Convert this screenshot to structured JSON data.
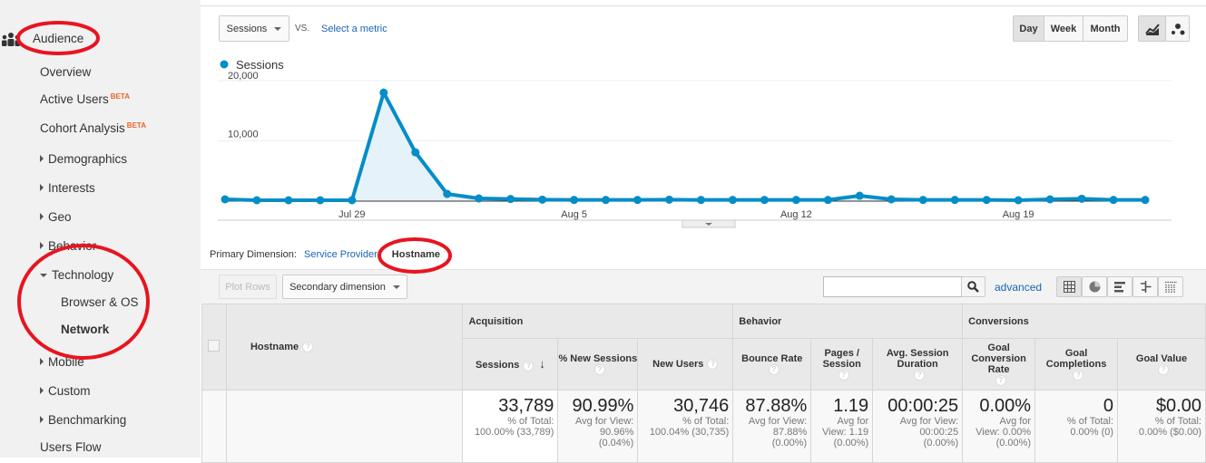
{
  "sidebar": {
    "section": "Audience",
    "items": [
      {
        "label": "Overview"
      },
      {
        "label": "Active Users",
        "badge": "BETA"
      },
      {
        "label": "Cohort Analysis",
        "badge": "BETA"
      },
      {
        "label": "Demographics"
      },
      {
        "label": "Interests"
      },
      {
        "label": "Geo"
      },
      {
        "label": "Behavior"
      },
      {
        "label": "Technology"
      },
      {
        "label": "Browser & OS"
      },
      {
        "label": "Network"
      },
      {
        "label": "Mobile"
      },
      {
        "label": "Custom"
      },
      {
        "label": "Benchmarking"
      },
      {
        "label": "Users Flow"
      }
    ]
  },
  "controls": {
    "metric": "Sessions",
    "vs": "VS.",
    "select_metric": "Select a metric",
    "day": "Day",
    "week": "Week",
    "month": "Month",
    "selected_interval": "Day"
  },
  "chart_data": {
    "type": "area",
    "legend": [
      "Sessions"
    ],
    "color": "#058dc7",
    "y_ticks": [
      "20,000",
      "10,000"
    ],
    "ylim": [
      0,
      22000
    ],
    "x_ticks": [
      "Jul 29",
      "Aug 5",
      "Aug 12",
      "Aug 19"
    ],
    "x": [
      "Jul 25",
      "Jul 26",
      "Jul 27",
      "Jul 28",
      "Jul 29",
      "Jul 30",
      "Jul 31",
      "Aug 1",
      "Aug 2",
      "Aug 3",
      "Aug 4",
      "Aug 5",
      "Aug 6",
      "Aug 7",
      "Aug 8",
      "Aug 9",
      "Aug 10",
      "Aug 11",
      "Aug 12",
      "Aug 13",
      "Aug 14",
      "Aug 15",
      "Aug 16",
      "Aug 17",
      "Aug 18",
      "Aug 19",
      "Aug 20",
      "Aug 21",
      "Aug 22",
      "Aug 23"
    ],
    "series": [
      {
        "name": "Sessions",
        "values": [
          300,
          150,
          150,
          150,
          150,
          18000,
          8100,
          1200,
          450,
          350,
          250,
          200,
          200,
          200,
          250,
          200,
          200,
          200,
          200,
          200,
          900,
          300,
          200,
          200,
          200,
          150,
          300,
          400,
          200,
          200
        ]
      }
    ]
  },
  "dimension": {
    "label": "Primary Dimension:",
    "service_provider": "Service Provider",
    "hostname": "Hostname"
  },
  "toolbar": {
    "plot_rows": "Plot Rows",
    "secondary": "Secondary dimension",
    "search_value": "",
    "advanced": "advanced"
  },
  "table": {
    "hostname_header": "Hostname",
    "groups": [
      "Acquisition",
      "Behavior",
      "Conversions"
    ],
    "columns": [
      {
        "label": "Sessions",
        "big": "33,789",
        "sub": [
          "% of Total:",
          "100.00% (33,789)"
        ]
      },
      {
        "label": "% New Sessions",
        "big": "90.99%",
        "sub": [
          "Avg for View:",
          "90.96%",
          "(0.04%)"
        ]
      },
      {
        "label": "New Users",
        "big": "30,746",
        "sub": [
          "% of Total:",
          "100.04% (30,735)"
        ]
      },
      {
        "label": "Bounce Rate",
        "big": "87.88%",
        "sub": [
          "Avg for View:",
          "87.88%",
          "(0.00%)"
        ]
      },
      {
        "label": "Pages / Session",
        "big": "1.19",
        "sub": [
          "Avg for",
          "View: 1.19",
          "(0.00%)"
        ]
      },
      {
        "label": "Avg. Session Duration",
        "big": "00:00:25",
        "sub": [
          "Avg for View:",
          "00:00:25",
          "(0.00%)"
        ]
      },
      {
        "label": "Goal Conversion Rate",
        "big": "0.00%",
        "sub": [
          "Avg for",
          "View: 0.00%",
          "(0.00%)"
        ]
      },
      {
        "label": "Goal Completions",
        "big": "0",
        "sub": [
          "% of Total:",
          "0.00% (0)"
        ]
      },
      {
        "label": "Goal Value",
        "big": "$0.00",
        "sub": [
          "% of Total:",
          "0.00% ($0.00)"
        ]
      }
    ]
  },
  "annotation_color": "#e8141f"
}
